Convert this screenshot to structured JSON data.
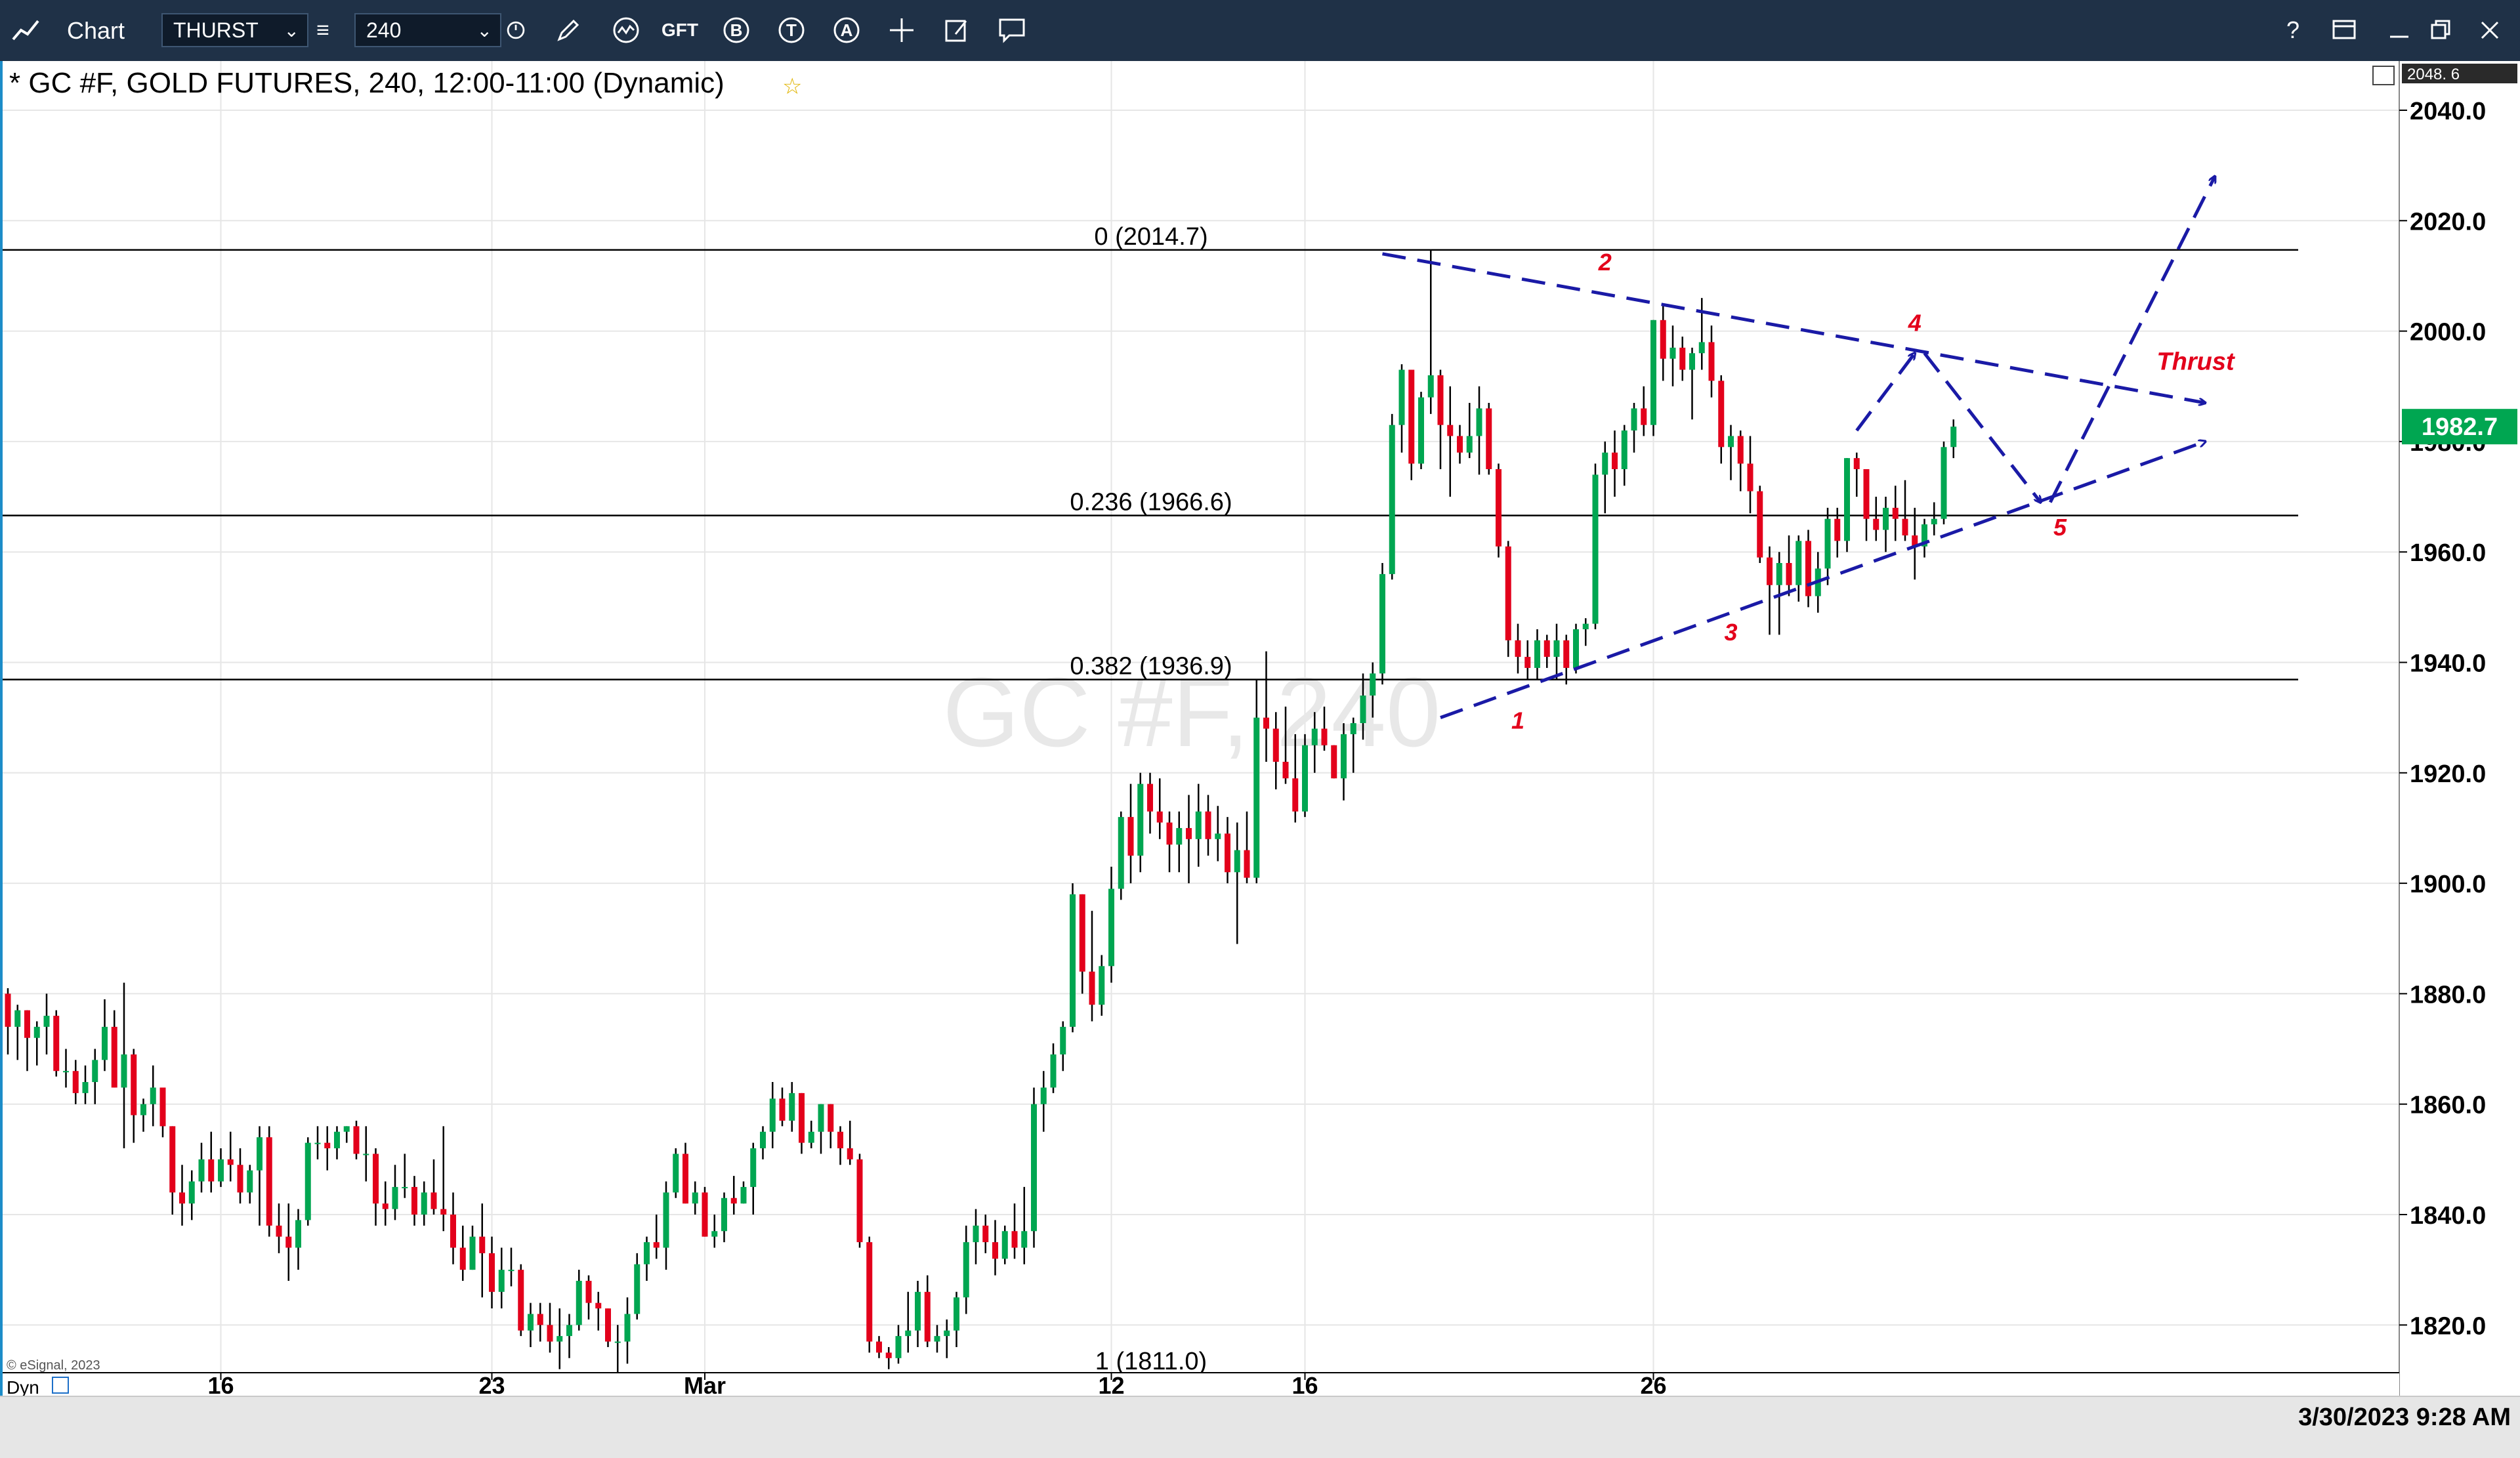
{
  "toolbar": {
    "app_label": "Chart",
    "symbol_value": "THURST",
    "interval_value": "240",
    "help_glyph": "?",
    "tool_glyphs": {
      "gft": "GFT",
      "b": "B",
      "t": "T",
      "a": "A"
    }
  },
  "status": {
    "timestamp": "3/30/2023 9:28 AM"
  },
  "chart_data": {
    "type": "candlestick",
    "title": "* GC #F, GOLD FUTURES, 240, 12:00-11:00 (Dynamic)",
    "watermark": "GC #F, 240",
    "copyright": "© eSignal, 2023",
    "dyn_label": "Dyn",
    "y_axis": {
      "ylim": [
        1808,
        2050
      ],
      "ticks": [
        1820,
        1840,
        1860,
        1880,
        1900,
        1920,
        1940,
        1960,
        1980,
        2000,
        2020,
        2040
      ],
      "tick_labels": [
        "1820.0",
        "1840.0",
        "1860.0",
        "1880.0",
        "1900.0",
        "1920.0",
        "1940.0",
        "1960.0",
        "1980.0",
        "2000.0",
        "2020.0",
        "2040.0"
      ],
      "top_value_label": "2048. 6",
      "last_price": 1982.7,
      "last_price_label": "1982.7",
      "last_price_color": "#00a651"
    },
    "x_axis": {
      "bar_count": 237,
      "tick_labels": [
        {
          "label": "16",
          "bar": 22
        },
        {
          "label": "23",
          "bar": 50
        },
        {
          "label": "Mar",
          "bar": 72
        },
        {
          "label": "12",
          "bar": 114
        },
        {
          "label": "16",
          "bar": 134
        },
        {
          "label": "26",
          "bar": 170
        }
      ]
    },
    "colors": {
      "up": "#00a651",
      "down": "#e3001b",
      "wick": "#000000",
      "pattern": "#1a1aa6",
      "labels": "#e3001b",
      "grid": "#e6e6e6"
    },
    "fib_levels": [
      {
        "ratio": "0",
        "value": 2014.7,
        "label": "0 (2014.7)"
      },
      {
        "ratio": "0.236",
        "value": 1966.6,
        "label": "0.236 (1966.6)"
      },
      {
        "ratio": "0.382",
        "value": 1936.9,
        "label": "0.382 (1936.9)"
      },
      {
        "ratio": "1",
        "value": 1811.0,
        "label": "1 (1811.0)"
      }
    ],
    "wave_labels": [
      {
        "label": "1",
        "bar": 156,
        "value": 1928
      },
      {
        "label": "2",
        "bar": 165,
        "value": 2011
      },
      {
        "label": "3",
        "bar": 178,
        "value": 1944
      },
      {
        "label": "4",
        "bar": 197,
        "value": 2000
      },
      {
        "label": "5",
        "bar": 212,
        "value": 1963
      },
      {
        "label": "Thrust",
        "bar": 226,
        "value": 1993
      }
    ],
    "pattern_lines": [
      {
        "from": [
          142,
          2014
        ],
        "to": [
          227,
          1987
        ],
        "arrow": true
      },
      {
        "from": [
          148,
          1930
        ],
        "to": [
          227,
          1980
        ],
        "arrow": true
      },
      {
        "from": [
          191,
          1982
        ],
        "to": [
          197,
          1996
        ],
        "arrow": true
      },
      {
        "from": [
          198,
          1996
        ],
        "to": [
          210,
          1969
        ],
        "arrow": true
      },
      {
        "from": [
          211,
          1969
        ],
        "to": [
          228,
          2028
        ],
        "arrow": true
      }
    ],
    "ohlc": [
      [
        1880.0,
        1881.0,
        1869.0,
        1874.0
      ],
      [
        1874.0,
        1878.0,
        1868.0,
        1877.0
      ],
      [
        1877.0,
        1877.0,
        1866.0,
        1872.0
      ],
      [
        1872.0,
        1875.0,
        1867.0,
        1874.0
      ],
      [
        1874.0,
        1880.0,
        1869.0,
        1876.0
      ],
      [
        1876.0,
        1877.0,
        1865.0,
        1866.0
      ],
      [
        1866.0,
        1870.0,
        1863.0,
        1866.0
      ],
      [
        1866.0,
        1868.0,
        1860.0,
        1862.0
      ],
      [
        1862.0,
        1867.0,
        1860.0,
        1864.0
      ],
      [
        1864.0,
        1870.0,
        1860.0,
        1868.0
      ],
      [
        1868.0,
        1879.0,
        1866.0,
        1874.0
      ],
      [
        1874.0,
        1877.0,
        1863.0,
        1863.0
      ],
      [
        1863.0,
        1882.0,
        1852.0,
        1869.0
      ],
      [
        1869.0,
        1870.0,
        1853.0,
        1858.0
      ],
      [
        1858.0,
        1861.0,
        1855.0,
        1860.0
      ],
      [
        1860.0,
        1867.0,
        1856.0,
        1863.0
      ],
      [
        1863.0,
        1863.0,
        1854.0,
        1856.0
      ],
      [
        1856.0,
        1856.0,
        1840.0,
        1844.0
      ],
      [
        1844.0,
        1849.0,
        1838.0,
        1842.0
      ],
      [
        1842.0,
        1848.0,
        1839.0,
        1846.0
      ],
      [
        1846.0,
        1853.0,
        1844.0,
        1850.0
      ],
      [
        1850.0,
        1855.0,
        1844.0,
        1846.0
      ],
      [
        1846.0,
        1852.0,
        1845.0,
        1850.0
      ],
      [
        1850.0,
        1855.0,
        1846.0,
        1849.0
      ],
      [
        1849.0,
        1852.0,
        1842.0,
        1844.0
      ],
      [
        1844.0,
        1849.0,
        1842.0,
        1848.0
      ],
      [
        1848.0,
        1856.0,
        1838.0,
        1854.0
      ],
      [
        1854.0,
        1856.0,
        1836.0,
        1838.0
      ],
      [
        1838.0,
        1842.0,
        1833.0,
        1836.0
      ],
      [
        1836.0,
        1842.0,
        1828.0,
        1834.0
      ],
      [
        1834.0,
        1841.0,
        1830.0,
        1839.0
      ],
      [
        1839.0,
        1854.0,
        1838.0,
        1853.0
      ],
      [
        1853.0,
        1856.0,
        1850.0,
        1853.0
      ],
      [
        1853.0,
        1856.0,
        1848.0,
        1852.0
      ],
      [
        1852.0,
        1856.0,
        1850.0,
        1855.0
      ],
      [
        1855.0,
        1856.0,
        1853.0,
        1856.0
      ],
      [
        1856.0,
        1857.0,
        1850.0,
        1851.0
      ],
      [
        1851.0,
        1856.0,
        1846.0,
        1851.0
      ],
      [
        1851.0,
        1852.0,
        1838.0,
        1842.0
      ],
      [
        1842.0,
        1846.0,
        1838.0,
        1841.0
      ],
      [
        1841.0,
        1849.0,
        1839.0,
        1845.0
      ],
      [
        1845.0,
        1851.0,
        1843.0,
        1845.0
      ],
      [
        1845.0,
        1847.0,
        1838.0,
        1840.0
      ],
      [
        1840.0,
        1846.0,
        1838.0,
        1844.0
      ],
      [
        1844.0,
        1850.0,
        1840.0,
        1841.0
      ],
      [
        1841.0,
        1856.0,
        1837.0,
        1840.0
      ],
      [
        1840.0,
        1844.0,
        1831.0,
        1834.0
      ],
      [
        1834.0,
        1838.0,
        1828.0,
        1830.0
      ],
      [
        1830.0,
        1838.0,
        1830.0,
        1836.0
      ],
      [
        1836.0,
        1842.0,
        1825.0,
        1833.0
      ],
      [
        1833.0,
        1836.0,
        1823.0,
        1826.0
      ],
      [
        1826.0,
        1834.0,
        1823.0,
        1830.0
      ],
      [
        1830.0,
        1834.0,
        1827.0,
        1830.0
      ],
      [
        1830.0,
        1831.0,
        1818.0,
        1819.0
      ],
      [
        1819.0,
        1824.0,
        1816.0,
        1822.0
      ],
      [
        1822.0,
        1824.0,
        1817.0,
        1820.0
      ],
      [
        1820.0,
        1824.0,
        1815.0,
        1817.0
      ],
      [
        1817.0,
        1823.0,
        1812.0,
        1818.0
      ],
      [
        1818.0,
        1822.0,
        1814.0,
        1820.0
      ],
      [
        1820.0,
        1830.0,
        1819.0,
        1828.0
      ],
      [
        1828.0,
        1829.0,
        1821.0,
        1824.0
      ],
      [
        1824.0,
        1826.0,
        1819.0,
        1823.0
      ],
      [
        1823.0,
        1823.0,
        1816.0,
        1817.0
      ],
      [
        1817.0,
        1820.0,
        1810.0,
        1817.0
      ],
      [
        1817.0,
        1825.0,
        1813.0,
        1822.0
      ],
      [
        1822.0,
        1833.0,
        1821.0,
        1831.0
      ],
      [
        1831.0,
        1836.0,
        1828.0,
        1835.0
      ],
      [
        1835.0,
        1840.0,
        1832.0,
        1834.0
      ],
      [
        1834.0,
        1846.0,
        1830.0,
        1844.0
      ],
      [
        1844.0,
        1852.0,
        1843.0,
        1851.0
      ],
      [
        1851.0,
        1853.0,
        1842.0,
        1842.0
      ],
      [
        1842.0,
        1846.0,
        1840.0,
        1844.0
      ],
      [
        1844.0,
        1845.0,
        1836.0,
        1836.0
      ],
      [
        1836.0,
        1840.0,
        1834.0,
        1837.0
      ],
      [
        1837.0,
        1844.0,
        1835.0,
        1843.0
      ],
      [
        1843.0,
        1847.0,
        1840.0,
        1842.0
      ],
      [
        1842.0,
        1846.0,
        1842.0,
        1845.0
      ],
      [
        1845.0,
        1853.0,
        1840.0,
        1852.0
      ],
      [
        1852.0,
        1856.0,
        1850.0,
        1855.0
      ],
      [
        1855.0,
        1864.0,
        1852.0,
        1861.0
      ],
      [
        1861.0,
        1863.0,
        1856.0,
        1857.0
      ],
      [
        1857.0,
        1864.0,
        1855.0,
        1862.0
      ],
      [
        1862.0,
        1862.0,
        1851.0,
        1853.0
      ],
      [
        1853.0,
        1857.0,
        1852.0,
        1855.0
      ],
      [
        1855.0,
        1860.0,
        1851.0,
        1860.0
      ],
      [
        1860.0,
        1860.0,
        1852.0,
        1855.0
      ],
      [
        1855.0,
        1856.0,
        1849.0,
        1852.0
      ],
      [
        1852.0,
        1857.0,
        1849.0,
        1850.0
      ],
      [
        1850.0,
        1851.0,
        1834.0,
        1835.0
      ],
      [
        1835.0,
        1836.0,
        1815.0,
        1817.0
      ],
      [
        1817.0,
        1818.0,
        1814.0,
        1815.0
      ],
      [
        1815.0,
        1816.0,
        1812.0,
        1814.0
      ],
      [
        1814.0,
        1820.0,
        1813.0,
        1818.0
      ],
      [
        1818.0,
        1826.0,
        1815.0,
        1819.0
      ],
      [
        1819.0,
        1828.0,
        1816.0,
        1826.0
      ],
      [
        1826.0,
        1829.0,
        1816.0,
        1817.0
      ],
      [
        1817.0,
        1820.0,
        1815.0,
        1818.0
      ],
      [
        1818.0,
        1821.0,
        1814.0,
        1819.0
      ],
      [
        1819.0,
        1826.0,
        1816.0,
        1825.0
      ],
      [
        1825.0,
        1838.0,
        1822.0,
        1835.0
      ],
      [
        1835.0,
        1841.0,
        1831.0,
        1838.0
      ],
      [
        1838.0,
        1840.0,
        1833.0,
        1835.0
      ],
      [
        1835.0,
        1839.0,
        1829.0,
        1832.0
      ],
      [
        1832.0,
        1838.0,
        1831.0,
        1837.0
      ],
      [
        1837.0,
        1842.0,
        1832.0,
        1834.0
      ],
      [
        1834.0,
        1845.0,
        1831.0,
        1837.0
      ],
      [
        1837.0,
        1863.0,
        1834.0,
        1860.0
      ],
      [
        1860.0,
        1866.0,
        1855.0,
        1863.0
      ],
      [
        1863.0,
        1871.0,
        1862.0,
        1869.0
      ],
      [
        1869.0,
        1875.0,
        1866.0,
        1874.0
      ],
      [
        1874.0,
        1900.0,
        1873.0,
        1898.0
      ],
      [
        1898.0,
        1898.0,
        1880.0,
        1884.0
      ],
      [
        1884.0,
        1895.0,
        1875.0,
        1878.0
      ],
      [
        1878.0,
        1887.0,
        1876.0,
        1885.0
      ],
      [
        1885.0,
        1903.0,
        1882.0,
        1899.0
      ],
      [
        1899.0,
        1913.0,
        1897.0,
        1912.0
      ],
      [
        1912.0,
        1918.0,
        1900.0,
        1905.0
      ],
      [
        1905.0,
        1920.0,
        1902.0,
        1918.0
      ],
      [
        1918.0,
        1920.0,
        1909.0,
        1913.0
      ],
      [
        1913.0,
        1919.0,
        1908.0,
        1911.0
      ],
      [
        1911.0,
        1913.0,
        1902.0,
        1907.0
      ],
      [
        1907.0,
        1913.0,
        1902.0,
        1910.0
      ],
      [
        1910.0,
        1916.0,
        1900.0,
        1908.0
      ],
      [
        1908.0,
        1918.0,
        1903.0,
        1913.0
      ],
      [
        1913.0,
        1916.0,
        1905.0,
        1908.0
      ],
      [
        1908.0,
        1914.0,
        1904.0,
        1909.0
      ],
      [
        1909.0,
        1912.0,
        1900.0,
        1902.0
      ],
      [
        1902.0,
        1911.0,
        1889.0,
        1906.0
      ],
      [
        1906.0,
        1913.0,
        1900.0,
        1901.0
      ],
      [
        1901.0,
        1937.0,
        1900.0,
        1930.0
      ],
      [
        1930.0,
        1942.0,
        1922.0,
        1928.0
      ],
      [
        1928.0,
        1931.0,
        1917.0,
        1922.0
      ],
      [
        1922.0,
        1932.0,
        1918.0,
        1919.0
      ],
      [
        1919.0,
        1927.0,
        1911.0,
        1913.0
      ],
      [
        1913.0,
        1927.0,
        1912.0,
        1925.0
      ],
      [
        1925.0,
        1931.0,
        1920.0,
        1928.0
      ],
      [
        1928.0,
        1932.0,
        1924.0,
        1925.0
      ],
      [
        1925.0,
        1925.0,
        1919.0,
        1919.0
      ],
      [
        1919.0,
        1929.0,
        1915.0,
        1927.0
      ],
      [
        1927.0,
        1930.0,
        1920.0,
        1929.0
      ],
      [
        1929.0,
        1938.0,
        1926.0,
        1934.0
      ],
      [
        1934.0,
        1940.0,
        1930.0,
        1938.0
      ],
      [
        1938.0,
        1958.0,
        1936.0,
        1956.0
      ],
      [
        1956.0,
        1985.0,
        1955.0,
        1983.0
      ],
      [
        1983.0,
        1994.0,
        1978.0,
        1993.0
      ],
      [
        1993.0,
        1993.0,
        1973.0,
        1976.0
      ],
      [
        1976.0,
        1989.0,
        1975.0,
        1988.0
      ],
      [
        1988.0,
        2014.7,
        1985.0,
        1992.0
      ],
      [
        1992.0,
        1993.0,
        1975.0,
        1983.0
      ],
      [
        1983.0,
        1990.0,
        1970.0,
        1981.0
      ],
      [
        1981.0,
        1983.0,
        1976.0,
        1978.0
      ],
      [
        1978.0,
        1987.0,
        1977.0,
        1981.0
      ],
      [
        1981.0,
        1990.0,
        1974.0,
        1986.0
      ],
      [
        1986.0,
        1987.0,
        1974.0,
        1975.0
      ],
      [
        1975.0,
        1976.0,
        1959.0,
        1961.0
      ],
      [
        1961.0,
        1962.0,
        1941.0,
        1944.0
      ],
      [
        1944.0,
        1947.0,
        1938.0,
        1941.0
      ],
      [
        1941.0,
        1944.0,
        1937.0,
        1939.0
      ],
      [
        1939.0,
        1946.0,
        1937.0,
        1944.0
      ],
      [
        1944.0,
        1945.0,
        1939.0,
        1941.0
      ],
      [
        1941.0,
        1947.0,
        1937.0,
        1944.0
      ],
      [
        1944.0,
        1945.0,
        1936.0,
        1939.0
      ],
      [
        1939.0,
        1947.0,
        1938.0,
        1946.0
      ],
      [
        1946.0,
        1948.0,
        1943.0,
        1947.0
      ],
      [
        1947.0,
        1976.0,
        1946.0,
        1974.0
      ],
      [
        1974.0,
        1980.0,
        1967.0,
        1978.0
      ],
      [
        1978.0,
        1982.0,
        1970.0,
        1975.0
      ],
      [
        1975.0,
        1983.0,
        1972.0,
        1982.0
      ],
      [
        1982.0,
        1987.0,
        1978.0,
        1986.0
      ],
      [
        1986.0,
        1990.0,
        1981.0,
        1983.0
      ],
      [
        1983.0,
        2002.0,
        1981.0,
        2002.0
      ],
      [
        2002.0,
        2005.0,
        1991.0,
        1995.0
      ],
      [
        1995.0,
        2001.0,
        1990.0,
        1997.0
      ],
      [
        1997.0,
        1999.0,
        1991.0,
        1993.0
      ],
      [
        1993.0,
        1997.0,
        1984.0,
        1996.0
      ],
      [
        1996.0,
        2006.0,
        1993.0,
        1998.0
      ],
      [
        1998.0,
        2001.0,
        1988.0,
        1991.0
      ],
      [
        1991.0,
        1992.0,
        1976.0,
        1979.0
      ],
      [
        1979.0,
        1983.0,
        1973.0,
        1981.0
      ],
      [
        1981.0,
        1982.0,
        1971.0,
        1976.0
      ],
      [
        1976.0,
        1981.0,
        1967.0,
        1971.0
      ],
      [
        1971.0,
        1972.0,
        1958.0,
        1959.0
      ],
      [
        1959.0,
        1961.0,
        1945.0,
        1954.0
      ],
      [
        1954.0,
        1960.0,
        1945.0,
        1958.0
      ],
      [
        1958.0,
        1963.0,
        1952.0,
        1954.0
      ],
      [
        1954.0,
        1963.0,
        1951.0,
        1962.0
      ],
      [
        1962.0,
        1964.0,
        1950.0,
        1952.0
      ],
      [
        1952.0,
        1960.0,
        1949.0,
        1957.0
      ],
      [
        1957.0,
        1968.0,
        1954.0,
        1966.0
      ],
      [
        1966.0,
        1968.0,
        1959.0,
        1962.0
      ],
      [
        1962.0,
        1977.0,
        1960.0,
        1977.0
      ],
      [
        1977.0,
        1978.0,
        1970.0,
        1975.0
      ],
      [
        1975.0,
        1975.0,
        1962.0,
        1966.0
      ],
      [
        1966.0,
        1970.0,
        1962.0,
        1964.0
      ],
      [
        1964.0,
        1970.0,
        1960.0,
        1968.0
      ],
      [
        1968.0,
        1972.0,
        1962.0,
        1966.0
      ],
      [
        1966.0,
        1973.0,
        1962.0,
        1963.0
      ],
      [
        1963.0,
        1968.0,
        1955.0,
        1961.0
      ],
      [
        1961.0,
        1966.0,
        1959.0,
        1965.0
      ],
      [
        1965.0,
        1969.0,
        1963.0,
        1966.0
      ],
      [
        1966.0,
        1980.0,
        1965.0,
        1979.0
      ],
      [
        1979.0,
        1984.0,
        1977.0,
        1982.7
      ]
    ]
  }
}
